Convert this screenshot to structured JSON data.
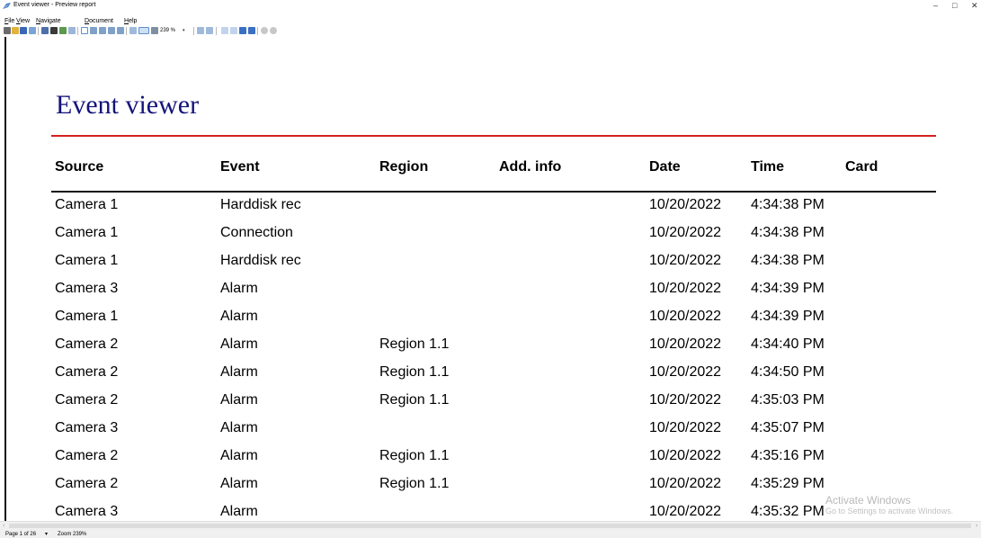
{
  "window": {
    "title": "Event viewer - Preview report",
    "minimize": "–",
    "restore": "□",
    "close": "✕"
  },
  "menu": {
    "items": [
      {
        "underline": "F",
        "rest": "ile"
      },
      {
        "underline": "V",
        "rest": "iew"
      },
      {
        "underline": "N",
        "rest": "avigate"
      },
      {
        "underline": "D",
        "rest": "ocument"
      },
      {
        "underline": "H",
        "rest": "elp"
      }
    ]
  },
  "toolbar": {
    "zoom_value": "239 %",
    "zoom_dropdown": "▾"
  },
  "report": {
    "title": "Event viewer",
    "columns": [
      "Source",
      "Event",
      "Region",
      "Add. info",
      "Date",
      "Time",
      "Card"
    ],
    "rows": [
      [
        "Camera 1",
        "Harddisk rec",
        "",
        "",
        "10/20/2022",
        "4:34:38 PM",
        ""
      ],
      [
        "Camera 1",
        "Connection",
        "",
        "",
        "10/20/2022",
        "4:34:38 PM",
        ""
      ],
      [
        "Camera 1",
        "Harddisk rec",
        "",
        "",
        "10/20/2022",
        "4:34:38 PM",
        ""
      ],
      [
        "Camera 3",
        "Alarm",
        "",
        "",
        "10/20/2022",
        "4:34:39 PM",
        ""
      ],
      [
        "Camera 1",
        "Alarm",
        "",
        "",
        "10/20/2022",
        "4:34:39 PM",
        ""
      ],
      [
        "Camera 2",
        "Alarm",
        "Region 1.1",
        "",
        "10/20/2022",
        "4:34:40 PM",
        ""
      ],
      [
        "Camera 2",
        "Alarm",
        "Region 1.1",
        "",
        "10/20/2022",
        "4:34:50 PM",
        ""
      ],
      [
        "Camera 2",
        "Alarm",
        "Region 1.1",
        "",
        "10/20/2022",
        "4:35:03 PM",
        ""
      ],
      [
        "Camera 3",
        "Alarm",
        "",
        "",
        "10/20/2022",
        "4:35:07 PM",
        ""
      ],
      [
        "Camera 2",
        "Alarm",
        "Region 1.1",
        "",
        "10/20/2022",
        "4:35:16 PM",
        ""
      ],
      [
        "Camera 2",
        "Alarm",
        "Region 1.1",
        "",
        "10/20/2022",
        "4:35:29 PM",
        ""
      ],
      [
        "Camera 3",
        "Alarm",
        "",
        "",
        "10/20/2022",
        "4:35:32 PM",
        ""
      ]
    ]
  },
  "watermark": {
    "line1": "Activate Windows",
    "line2": "Go to Settings to activate Windows."
  },
  "status": {
    "page": "Page 1 of 26",
    "page_dropdown": "▾",
    "zoom": "Zoom 239%"
  },
  "scroll": {
    "left_arrow": "‹",
    "right_arrow": "›"
  },
  "colors": {
    "title": "#13137a",
    "title_rule": "#d42020"
  },
  "toolbar_icons": [
    "print-icon",
    "open-folder-icon",
    "save-icon",
    "export-icon",
    "separator",
    "table-icon",
    "binoculars-icon",
    "email-icon",
    "page-setup-icon",
    "separator",
    "hand-tool-icon",
    "zoom-in-icon",
    "zoom-out-icon",
    "zoom-out-2-icon",
    "zoom-area-icon",
    "separator",
    "one-page-icon",
    "page-width-icon",
    "whole-page-icon",
    "zoom-select",
    "separator",
    "page-layout-icon",
    "two-pages-icon",
    "separator",
    "first-page-icon",
    "previous-page-icon",
    "next-page-icon",
    "last-page-icon",
    "separator",
    "stop-icon",
    "refresh-icon"
  ]
}
